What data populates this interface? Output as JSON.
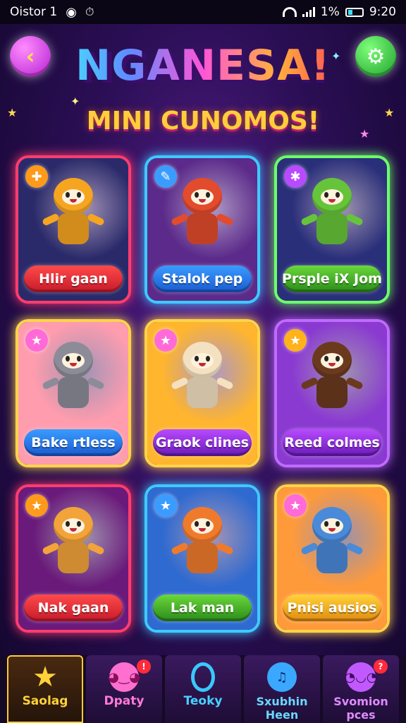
{
  "status_bar": {
    "carrier": "Oistor 1",
    "battery_percent": "1%",
    "time": "9:20"
  },
  "header": {
    "title": "NGANESA!",
    "subtitle": "MINI CUNOMOS!",
    "back_icon": "chevron-left-icon",
    "settings_icon": "gear-icon"
  },
  "cards": [
    {
      "label": "Hlir gaan",
      "badge": "✚",
      "theme": "red",
      "char_color": "#f6a521",
      "bg": "#2a2a6a"
    },
    {
      "label": "Stalok pep",
      "badge": "✎",
      "theme": "blue",
      "char_color": "#e24b2c",
      "bg": "#5b2a8a"
    },
    {
      "label": "Prsple iX Jom",
      "badge": "✱",
      "theme": "green",
      "char_color": "#66c43a",
      "bg": "#2a2f7a"
    },
    {
      "label": "Bake rtless",
      "badge": "★",
      "theme": "gold",
      "char_color": "#8c8c99",
      "bg": "#ff9cae"
    },
    {
      "label": "Graok clines",
      "badge": "★",
      "theme": "gold",
      "char_color": "#f3e1c1",
      "bg": "#ffb52e"
    },
    {
      "label": "Reed colmes",
      "badge": "★",
      "theme": "purple",
      "char_color": "#6b3a1e",
      "bg": "#8a3ad0"
    },
    {
      "label": "Nak gaan",
      "badge": "★",
      "theme": "red",
      "char_color": "#f2a33a",
      "bg": "#6a1a7a"
    },
    {
      "label": "Lak man",
      "badge": "★",
      "theme": "blue",
      "char_color": "#f07a2c",
      "bg": "#2f6ad0"
    },
    {
      "label": "Pnisi ausios",
      "badge": "★",
      "theme": "gold",
      "char_color": "#4a8ad8",
      "bg": "#ff9a3a"
    }
  ],
  "bottom_nav": [
    {
      "label": "Saolag",
      "icon": "star-icon",
      "active": true,
      "badge": ""
    },
    {
      "label": "Dpaty",
      "icon": "pig-face-icon",
      "active": false,
      "badge": "!"
    },
    {
      "label": "Teoky",
      "icon": "ring-icon",
      "active": false,
      "badge": ""
    },
    {
      "label": "Sxubhin Heen",
      "icon": "music-blob-icon",
      "active": false,
      "badge": ""
    },
    {
      "label": "Svomion pces",
      "icon": "monster-face-icon",
      "active": false,
      "badge": "?"
    }
  ]
}
